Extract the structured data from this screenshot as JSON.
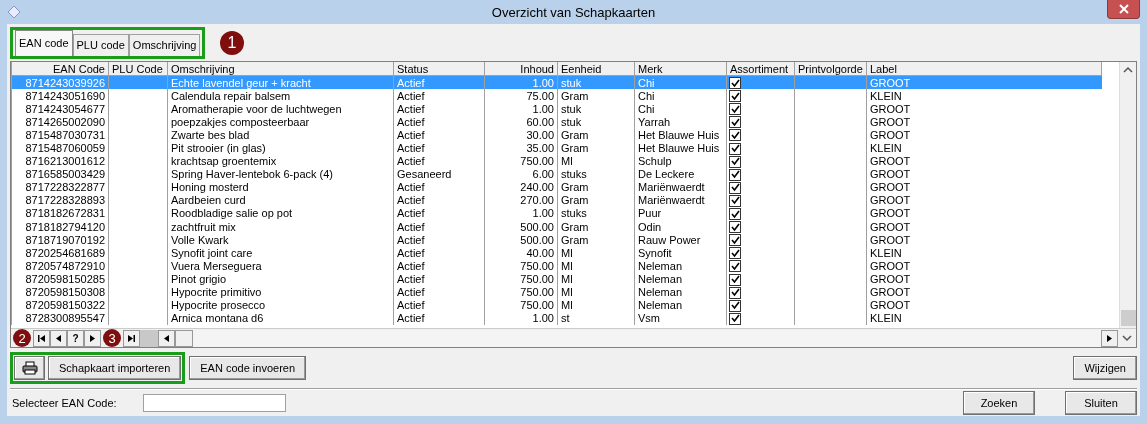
{
  "window": {
    "title": "Overzicht van Schapkaarten"
  },
  "tabs": [
    {
      "label": "EAN code",
      "selected": true
    },
    {
      "label": "PLU code",
      "selected": false
    },
    {
      "label": "Omschrijving",
      "selected": false
    }
  ],
  "callouts": [
    "1",
    "2",
    "3"
  ],
  "table": {
    "columns": [
      "EAN Code",
      "PLU Code",
      "Omschrijving",
      "Status",
      "Inhoud",
      "Eenheid",
      "Merk",
      "Assortiment",
      "Printvolgorde",
      "Label"
    ],
    "rows": [
      {
        "ean": "8714243039926",
        "description": "Echte lavendel geur + kracht",
        "status": "Actief",
        "amount": "1.00",
        "unit": "stuk",
        "brand": "Chi",
        "assortment": true,
        "label": "GROOT",
        "selected": true
      },
      {
        "ean": "8714243051690",
        "description": "Calendula repair balsem",
        "status": "Actief",
        "amount": "75.00",
        "unit": "Gram",
        "brand": "Chi",
        "assortment": true,
        "label": "KLEIN",
        "selected": false
      },
      {
        "ean": "8714243054677",
        "description": "Aromatherapie voor de luchtwegen",
        "status": "Actief",
        "amount": "1.00",
        "unit": "stuk",
        "brand": "Chi",
        "assortment": true,
        "label": "GROOT",
        "selected": false
      },
      {
        "ean": "8714265002090",
        "description": "poepzakjes composteerbaar",
        "status": "Actief",
        "amount": "60.00",
        "unit": "stuk",
        "brand": "Yarrah",
        "assortment": true,
        "label": "GROOT",
        "selected": false
      },
      {
        "ean": "8715487030731",
        "description": "Zwarte bes blad",
        "status": "Actief",
        "amount": "30.00",
        "unit": "Gram",
        "brand": "Het Blauwe Huis",
        "assortment": true,
        "label": "GROOT",
        "selected": false
      },
      {
        "ean": "8715487060059",
        "description": "Pit strooier (in glas)",
        "status": "Actief",
        "amount": "35.00",
        "unit": "Gram",
        "brand": "Het Blauwe Huis",
        "assortment": true,
        "label": "KLEIN",
        "selected": false
      },
      {
        "ean": "8716213001612",
        "description": "krachtsap groentemix",
        "status": "Actief",
        "amount": "750.00",
        "unit": "Ml",
        "brand": "Schulp",
        "assortment": true,
        "label": "GROOT",
        "selected": false
      },
      {
        "ean": "8716585003429",
        "description": "Spring Haver-lentebok 6-pack (4)",
        "status": "Gesaneerd",
        "amount": "6.00",
        "unit": "stuks",
        "brand": "De Leckere",
        "assortment": true,
        "label": "GROOT",
        "selected": false
      },
      {
        "ean": "8717228322877",
        "description": "Honing mosterd",
        "status": "Actief",
        "amount": "240.00",
        "unit": "Gram",
        "brand": "Mariënwaerdt",
        "assortment": true,
        "label": "GROOT",
        "selected": false
      },
      {
        "ean": "8717228328893",
        "description": "Aardbeien curd",
        "status": "Actief",
        "amount": "270.00",
        "unit": "Gram",
        "brand": "Mariënwaerdt",
        "assortment": true,
        "label": "GROOT",
        "selected": false
      },
      {
        "ean": "8718182672831",
        "description": "Roodbladige salie op pot",
        "status": "Actief",
        "amount": "1.00",
        "unit": "stuks",
        "brand": "Puur",
        "assortment": true,
        "label": "GROOT",
        "selected": false
      },
      {
        "ean": "8718182794120",
        "description": "zachtfruit mix",
        "status": "Actief",
        "amount": "500.00",
        "unit": "Gram",
        "brand": "Odin",
        "assortment": true,
        "label": "GROOT",
        "selected": false
      },
      {
        "ean": "8718719070192",
        "description": "Volle Kwark",
        "status": "Actief",
        "amount": "500.00",
        "unit": "Gram",
        "brand": "Rauw Power",
        "assortment": true,
        "label": "GROOT",
        "selected": false
      },
      {
        "ean": "8720254681689",
        "description": "Synofit joint care",
        "status": "Actief",
        "amount": "40.00",
        "unit": "Ml",
        "brand": "Synofit",
        "assortment": true,
        "label": "KLEIN",
        "selected": false
      },
      {
        "ean": "8720574872910",
        "description": "Vuera Merseguera",
        "status": "Actief",
        "amount": "750.00",
        "unit": "Ml",
        "brand": "Neleman",
        "assortment": true,
        "label": "GROOT",
        "selected": false
      },
      {
        "ean": "8720598150285",
        "description": "Pinot grigio",
        "status": "Actief",
        "amount": "750.00",
        "unit": "Ml",
        "brand": "Neleman",
        "assortment": true,
        "label": "GROOT",
        "selected": false
      },
      {
        "ean": "8720598150308",
        "description": "Hypocrite primitivo",
        "status": "Actief",
        "amount": "750.00",
        "unit": "Ml",
        "brand": "Neleman",
        "assortment": true,
        "label": "GROOT",
        "selected": false
      },
      {
        "ean": "8720598150322",
        "description": "Hypocrite prosecco",
        "status": "Actief",
        "amount": "750.00",
        "unit": "Ml",
        "brand": "Neleman",
        "assortment": true,
        "label": "GROOT",
        "selected": false
      },
      {
        "ean": "8728300895547",
        "description": "Arnica montana d6",
        "status": "Actief",
        "amount": "1.00",
        "unit": "st",
        "brand": "Vsm",
        "assortment": true,
        "label": "KLEIN",
        "selected": false
      }
    ]
  },
  "pager": {
    "help": "?"
  },
  "buttons": [
    "Schapkaart importeren",
    "EAN code invoeren",
    "Wijzigen"
  ],
  "ean_search": {
    "label": "Selecteer EAN Code:"
  },
  "footer_buttons": [
    "Zoeken",
    "Sluiten"
  ]
}
